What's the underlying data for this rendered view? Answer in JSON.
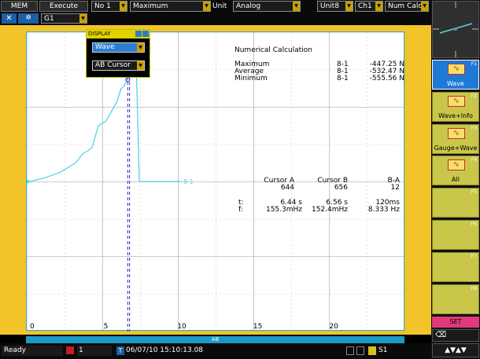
{
  "toolbar": {
    "mode": "MEM",
    "execute": "Execute",
    "group": "G1",
    "number": "No 1",
    "calc_type": "Maximum",
    "unit_label": "Unit",
    "unit_value": "Analog",
    "unit_no": "Unit8",
    "channel": "Ch1",
    "num_calc": "Num Calc"
  },
  "display_popup": {
    "title": "DISPLAY",
    "wave_select": "Wave",
    "cursor_select": "AB Cursor"
  },
  "numerical": {
    "title": "Numerical Calculation",
    "rows": [
      {
        "label": "Maximum",
        "channel": "8-1",
        "value": "-447.25 N"
      },
      {
        "label": "Average",
        "channel": "8-1",
        "value": "-532.47 N"
      },
      {
        "label": "Minimum",
        "channel": "8-1",
        "value": "-555.56 N"
      }
    ]
  },
  "cursor_table": {
    "headers": [
      "Cursor A",
      "Cursor B",
      "B-A"
    ],
    "index": [
      "644",
      "656",
      "12"
    ],
    "t": {
      "label": "t:",
      "values": [
        "6.44 s",
        "6.56 s",
        "120ms"
      ]
    },
    "f": {
      "label": "f:",
      "values": [
        "155.3mHz",
        "152.4mHz",
        "8.333 Hz"
      ]
    }
  },
  "plot": {
    "trace_label": "8-1",
    "x_ticks": [
      "0",
      "5",
      "10",
      "15",
      "20"
    ],
    "cursor_a_label": "A",
    "cursor_b_label": "B",
    "scroll_label": "AB"
  },
  "chart_data": {
    "type": "line",
    "x_range": [
      0,
      24.5
    ],
    "tick_labels": [
      "0",
      "5",
      "10",
      "15",
      "20"
    ],
    "series": [
      {
        "color": "#4fd6e8",
        "x": [
          0,
          1.0,
          2.0,
          3.0,
          3.5,
          3.9,
          4.1,
          4.5,
          5.0,
          5.7,
          6.0,
          6.2,
          6.4,
          6.5,
          6.6,
          6.75,
          6.9,
          7.0,
          7.2,
          10.0
        ],
        "y": [
          0,
          0.04,
          0.1,
          0.2,
          0.3,
          0.34,
          0.37,
          0.6,
          0.65,
          0.85,
          1.0,
          1.03,
          1.1,
          1.15,
          1.3,
          1.55,
          1.8,
          1.3,
          0.0,
          0.0
        ]
      }
    ],
    "cursors": {
      "A": 6.44,
      "B": 6.56
    },
    "grid": true
  },
  "right_panel": {
    "items": [
      {
        "label": "Wave",
        "fkey": "F1"
      },
      {
        "label": "Wave+Info",
        "fkey": "F2"
      },
      {
        "label": "Gauge+Wave",
        "fkey": "F3"
      },
      {
        "label": "All",
        "fkey": "F4"
      },
      {
        "label": "",
        "fkey": "F5"
      },
      {
        "label": "",
        "fkey": "F6"
      },
      {
        "label": "",
        "fkey": "F7"
      },
      {
        "label": "",
        "fkey": "F8"
      }
    ],
    "set_label": "SET"
  },
  "status": {
    "state": "Ready",
    "page": "1",
    "datetime": "06/07/10 15:10:13.08",
    "trigger_label": "T",
    "sheet": "S1"
  }
}
